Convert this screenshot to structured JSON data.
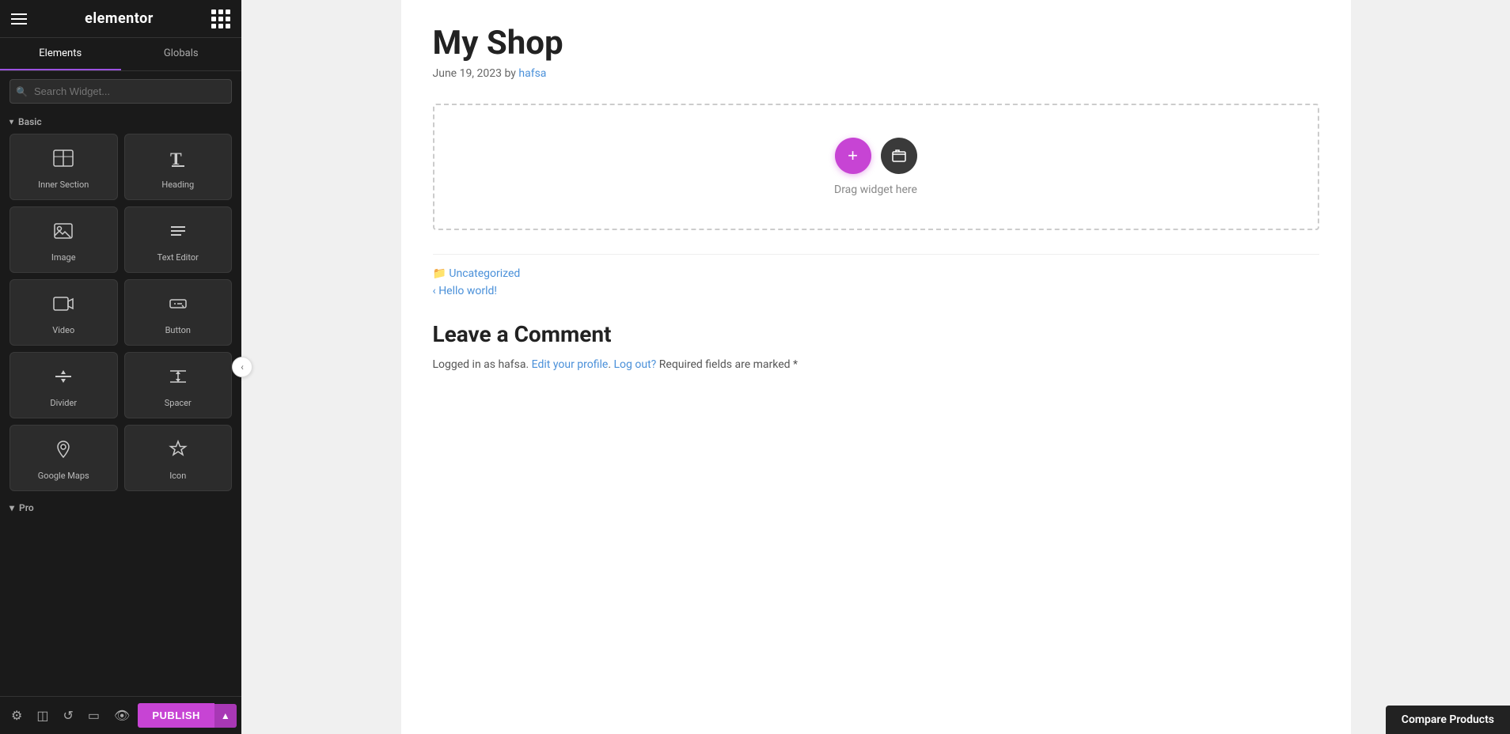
{
  "panel": {
    "logo": "elementor",
    "tabs": [
      {
        "label": "Elements",
        "active": true
      },
      {
        "label": "Globals",
        "active": false
      }
    ],
    "search_placeholder": "Search Widget...",
    "sections": {
      "basic": {
        "label": "Basic",
        "widgets": [
          {
            "id": "inner-section",
            "label": "Inner Section",
            "icon": "inner-section"
          },
          {
            "id": "heading",
            "label": "Heading",
            "icon": "heading"
          },
          {
            "id": "image",
            "label": "Image",
            "icon": "image"
          },
          {
            "id": "text-editor",
            "label": "Text Editor",
            "icon": "text-editor"
          },
          {
            "id": "video",
            "label": "Video",
            "icon": "video"
          },
          {
            "id": "button",
            "label": "Button",
            "icon": "button"
          },
          {
            "id": "divider",
            "label": "Divider",
            "icon": "divider"
          },
          {
            "id": "spacer",
            "label": "Spacer",
            "icon": "spacer"
          },
          {
            "id": "google-maps",
            "label": "Google Maps",
            "icon": "google-maps"
          },
          {
            "id": "icon",
            "label": "Icon",
            "icon": "icon"
          }
        ]
      },
      "pro": {
        "label": "Pro"
      }
    },
    "bottom_icons": [
      "settings",
      "layers",
      "history",
      "responsive",
      "preview"
    ],
    "publish_label": "PUBLISH"
  },
  "content": {
    "post_title": "My Shop",
    "post_meta": "June 19, 2023 by",
    "post_author": "hafsa",
    "drop_zone_hint": "Drag widget here",
    "footer": {
      "category": "Uncategorized",
      "prev_post": "Hello world!"
    },
    "comments": {
      "title": "Leave a Comment",
      "logged_in_text": "Logged in as hafsa.",
      "edit_profile": "Edit your profile",
      "logout": "Log out?",
      "required_text": "Required fields are marked",
      "required_marker": "*"
    }
  },
  "compare_bar": {
    "label": "Compare Products"
  }
}
